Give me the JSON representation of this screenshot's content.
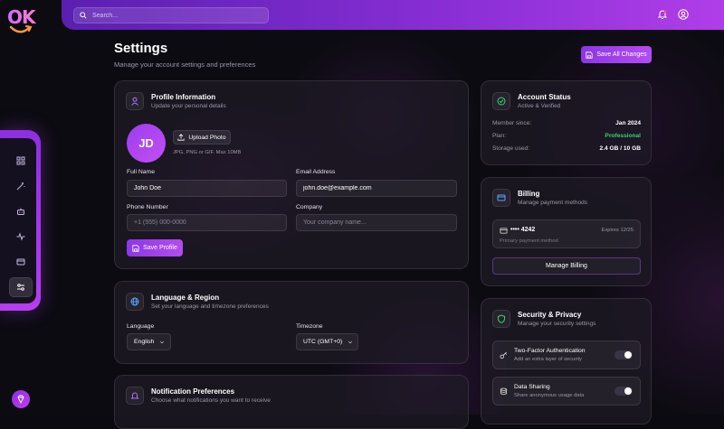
{
  "app": {
    "logo_text": "OK"
  },
  "topbar": {
    "search_placeholder": "Search..."
  },
  "page": {
    "title": "Settings",
    "subtitle": "Manage your account settings and preferences",
    "save_all_label": "Save All Changes"
  },
  "profile": {
    "title": "Profile Information",
    "subtitle": "Update your personal details",
    "initials": "JD",
    "upload_label": "Upload Photo",
    "upload_hint": "JPG, PNG or GIF. Max 10MB",
    "full_name_label": "Full Name",
    "full_name_value": "John Doe",
    "email_label": "Email Address",
    "email_value": "john.doe@example.com",
    "phone_label": "Phone Number",
    "phone_placeholder": "+1 (555) 000-0000",
    "company_label": "Company",
    "company_placeholder": "Your company name...",
    "save_label": "Save Profile"
  },
  "language": {
    "title": "Language & Region",
    "subtitle": "Set your language and timezone preferences",
    "language_label": "Language",
    "language_value": "English",
    "timezone_label": "Timezone",
    "timezone_value": "UTC (GMT+0)"
  },
  "notifications": {
    "title": "Notification Preferences",
    "subtitle": "Choose what notifications you want to receive"
  },
  "account": {
    "title": "Account Status",
    "subtitle": "Active & Verified",
    "rows": [
      {
        "k": "Member since:",
        "v": "Jan 2024"
      },
      {
        "k": "Plan:",
        "v": "Professional"
      },
      {
        "k": "Storage used:",
        "v": "2.4 GB / 10 GB"
      }
    ]
  },
  "billing": {
    "title": "Billing",
    "subtitle": "Manage payment methods",
    "card_number": "•••• 4242",
    "card_expiry": "Expires 12/25",
    "card_note": "Primary payment method",
    "manage_label": "Manage Billing"
  },
  "security": {
    "title": "Security & Privacy",
    "subtitle": "Manage your security settings",
    "items": [
      {
        "title": "Two-Factor Authentication",
        "sub": "Add an extra layer of security",
        "enabled": false
      },
      {
        "title": "Data Sharing",
        "sub": "Share anonymous usage data",
        "enabled": false
      }
    ]
  },
  "colors": {
    "accent": "#9b3ff0",
    "success": "#3bd16f"
  }
}
